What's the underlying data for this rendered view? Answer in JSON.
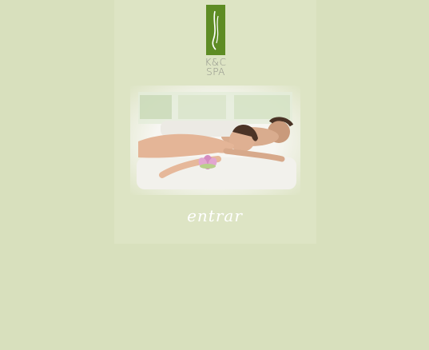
{
  "brand": {
    "line1": "K&C",
    "line2": "SPA",
    "logo_icon": "leaf-stroke-icon",
    "logo_color": "#5e8c24"
  },
  "hero": {
    "image": "couple-massage-photo",
    "flower_icon": "lotus-flower-icon"
  },
  "enter_link": {
    "label": "entrar"
  },
  "colors": {
    "background": "#d8e0bd",
    "panel": "#dde4c4",
    "text_brand": "#8d8f87",
    "link": "#ffffff"
  }
}
